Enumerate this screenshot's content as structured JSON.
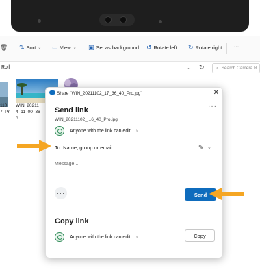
{
  "toolbar": {
    "sort_label": "Sort",
    "view_label": "View",
    "set_background_label": "Set as background",
    "rotate_left_label": "Rotate left",
    "rotate_right_label": "Rotate right",
    "more_label": "···"
  },
  "address": {
    "path_text": "Roll",
    "search_placeholder": "Search Camera R"
  },
  "files": [
    {
      "label": "110\n7_Pr"
    },
    {
      "label": "WIN_20211\n4_11_00_36_\no"
    }
  ],
  "dialog": {
    "title": "Share \"WIN_20211102_17_36_40_Pro.jpg\"",
    "close": "✕",
    "more": "···",
    "send_heading": "Send link",
    "filename": "WIN_20211102_...6_40_Pro.jpg",
    "permission_text": "Anyone with the link can edit",
    "permission_chevron": "›",
    "to_placeholder": "To: Name, group or email",
    "message_placeholder": "Message...",
    "options_label": "···",
    "send_label": "Send",
    "copy_heading": "Copy link",
    "copy_permission_text": "Anyone with the link can edit",
    "copy_label": "Copy"
  },
  "colors": {
    "accent": "#0f6cbd",
    "arrow": "#f5a623",
    "globe": "#2e8b57"
  }
}
